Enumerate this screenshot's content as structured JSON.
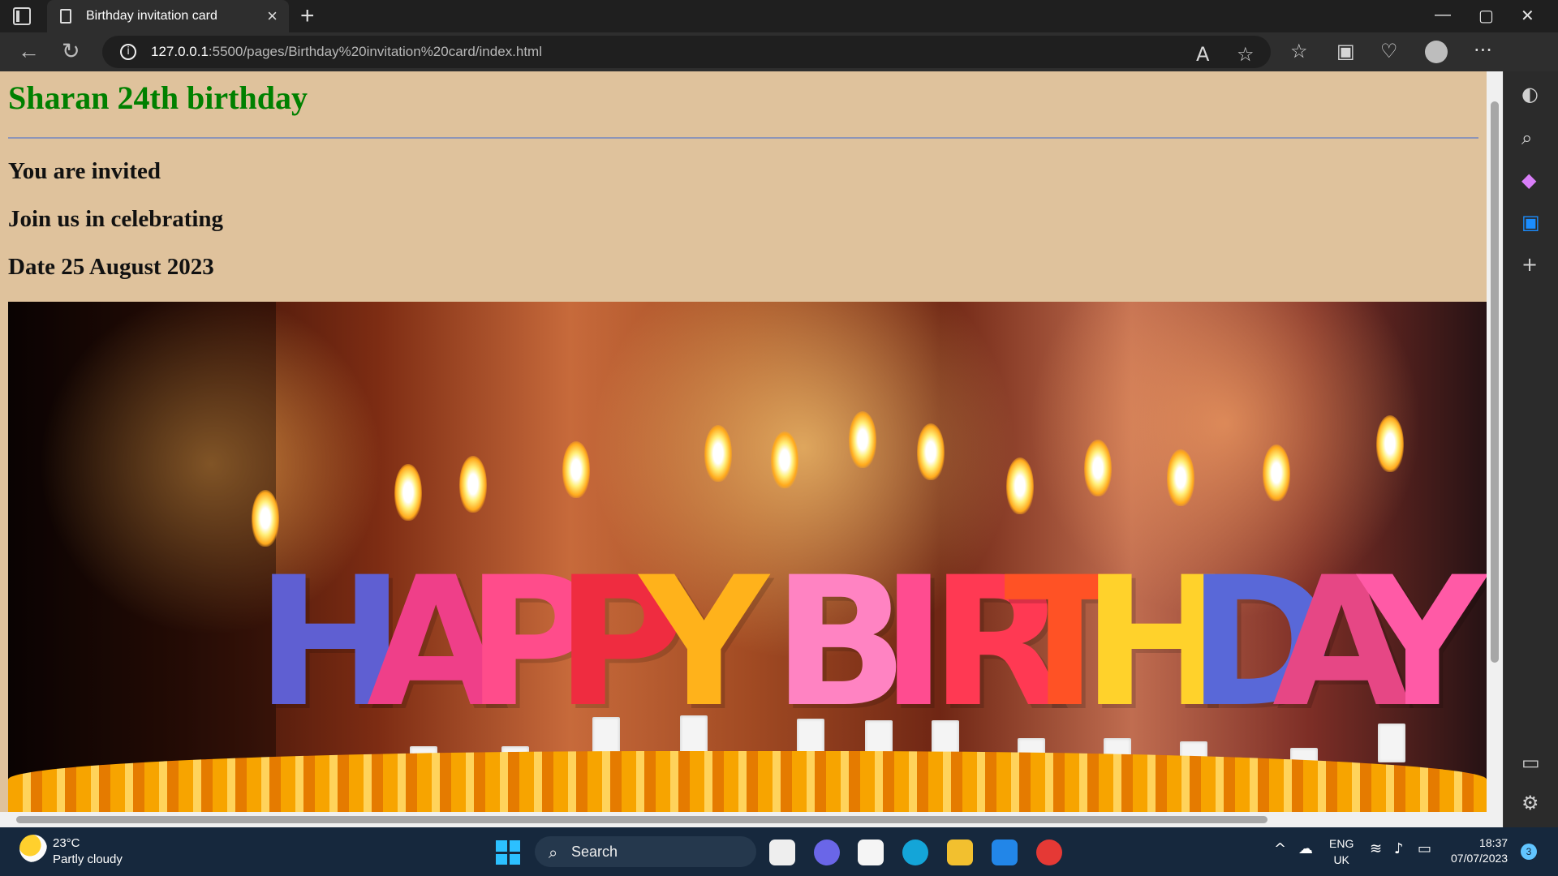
{
  "browser": {
    "tab_title": "Birthday invitation card",
    "tab_close": "×",
    "new_tab": "+",
    "url_host": "127.0.0.1",
    "url_path": ":5500/pages/Birthday%20invitation%20card/index.html",
    "read_aloud": "A",
    "favorite": "☆",
    "more": "···"
  },
  "page": {
    "heading": "Sharan 24th birthday",
    "line1": "You are invited",
    "line2": "Join us in celebrating",
    "line3": "Date 25 August 2023",
    "image_text": "HAPPY BIRTHDAY"
  },
  "taskbar": {
    "temperature": "23°C",
    "weather": "Partly cloudy",
    "search_label": "Search",
    "language": "ENG",
    "region": "UK",
    "time": "18:37",
    "date": "07/07/2023",
    "notification_count": "3"
  },
  "colors": {
    "page_background": "#dfc29c",
    "heading": "#008000",
    "taskbar": "#16283d"
  }
}
